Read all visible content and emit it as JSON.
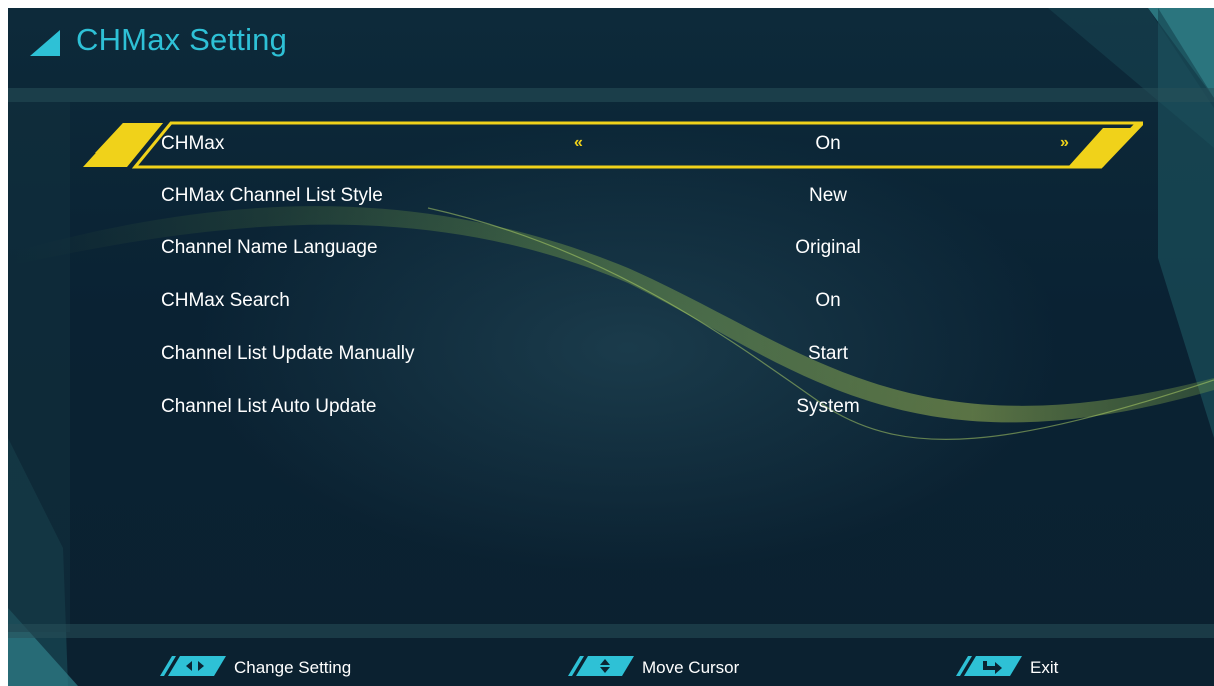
{
  "header": {
    "title": "CHMax Setting"
  },
  "menu": {
    "selected_arrow_left": "«",
    "selected_arrow_right": "»",
    "items": [
      {
        "label": "CHMax",
        "value": "On",
        "selected": true
      },
      {
        "label": "CHMax Channel List Style",
        "value": "New"
      },
      {
        "label": "Channel Name Language",
        "value": "Original"
      },
      {
        "label": "CHMax Search",
        "value": "On"
      },
      {
        "label": "Channel List Update Manually",
        "value": "Start"
      },
      {
        "label": "Channel List Auto Update",
        "value": "System"
      }
    ]
  },
  "footer": {
    "hints": [
      {
        "icon": "left-right-arrows-icon",
        "label": "Change Setting"
      },
      {
        "icon": "up-down-arrows-icon",
        "label": "Move Cursor"
      },
      {
        "icon": "return-arrow-icon",
        "label": "Exit"
      }
    ]
  },
  "colors": {
    "accent_yellow": "#f0d21a",
    "title_cyan": "#2ec1d6",
    "background": "#0b2433"
  }
}
